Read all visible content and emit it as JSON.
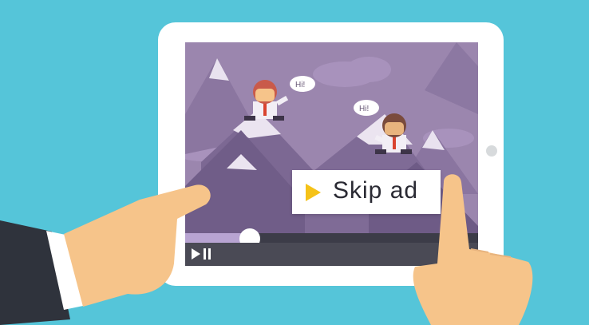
{
  "video": {
    "skip_label": "Skip ad",
    "progress": 0.22,
    "speech_1": "Hi!",
    "speech_2": "Hi!"
  },
  "icons": {
    "play": "play-icon",
    "pause": "pause-icon",
    "skip": "play-triangle-icon"
  },
  "colors": {
    "background": "#55c5d9",
    "video_sky": "#9b86ae",
    "skip_accent": "#f5c218",
    "skin": "#f6c48a",
    "sleeve": "#2f333c"
  }
}
